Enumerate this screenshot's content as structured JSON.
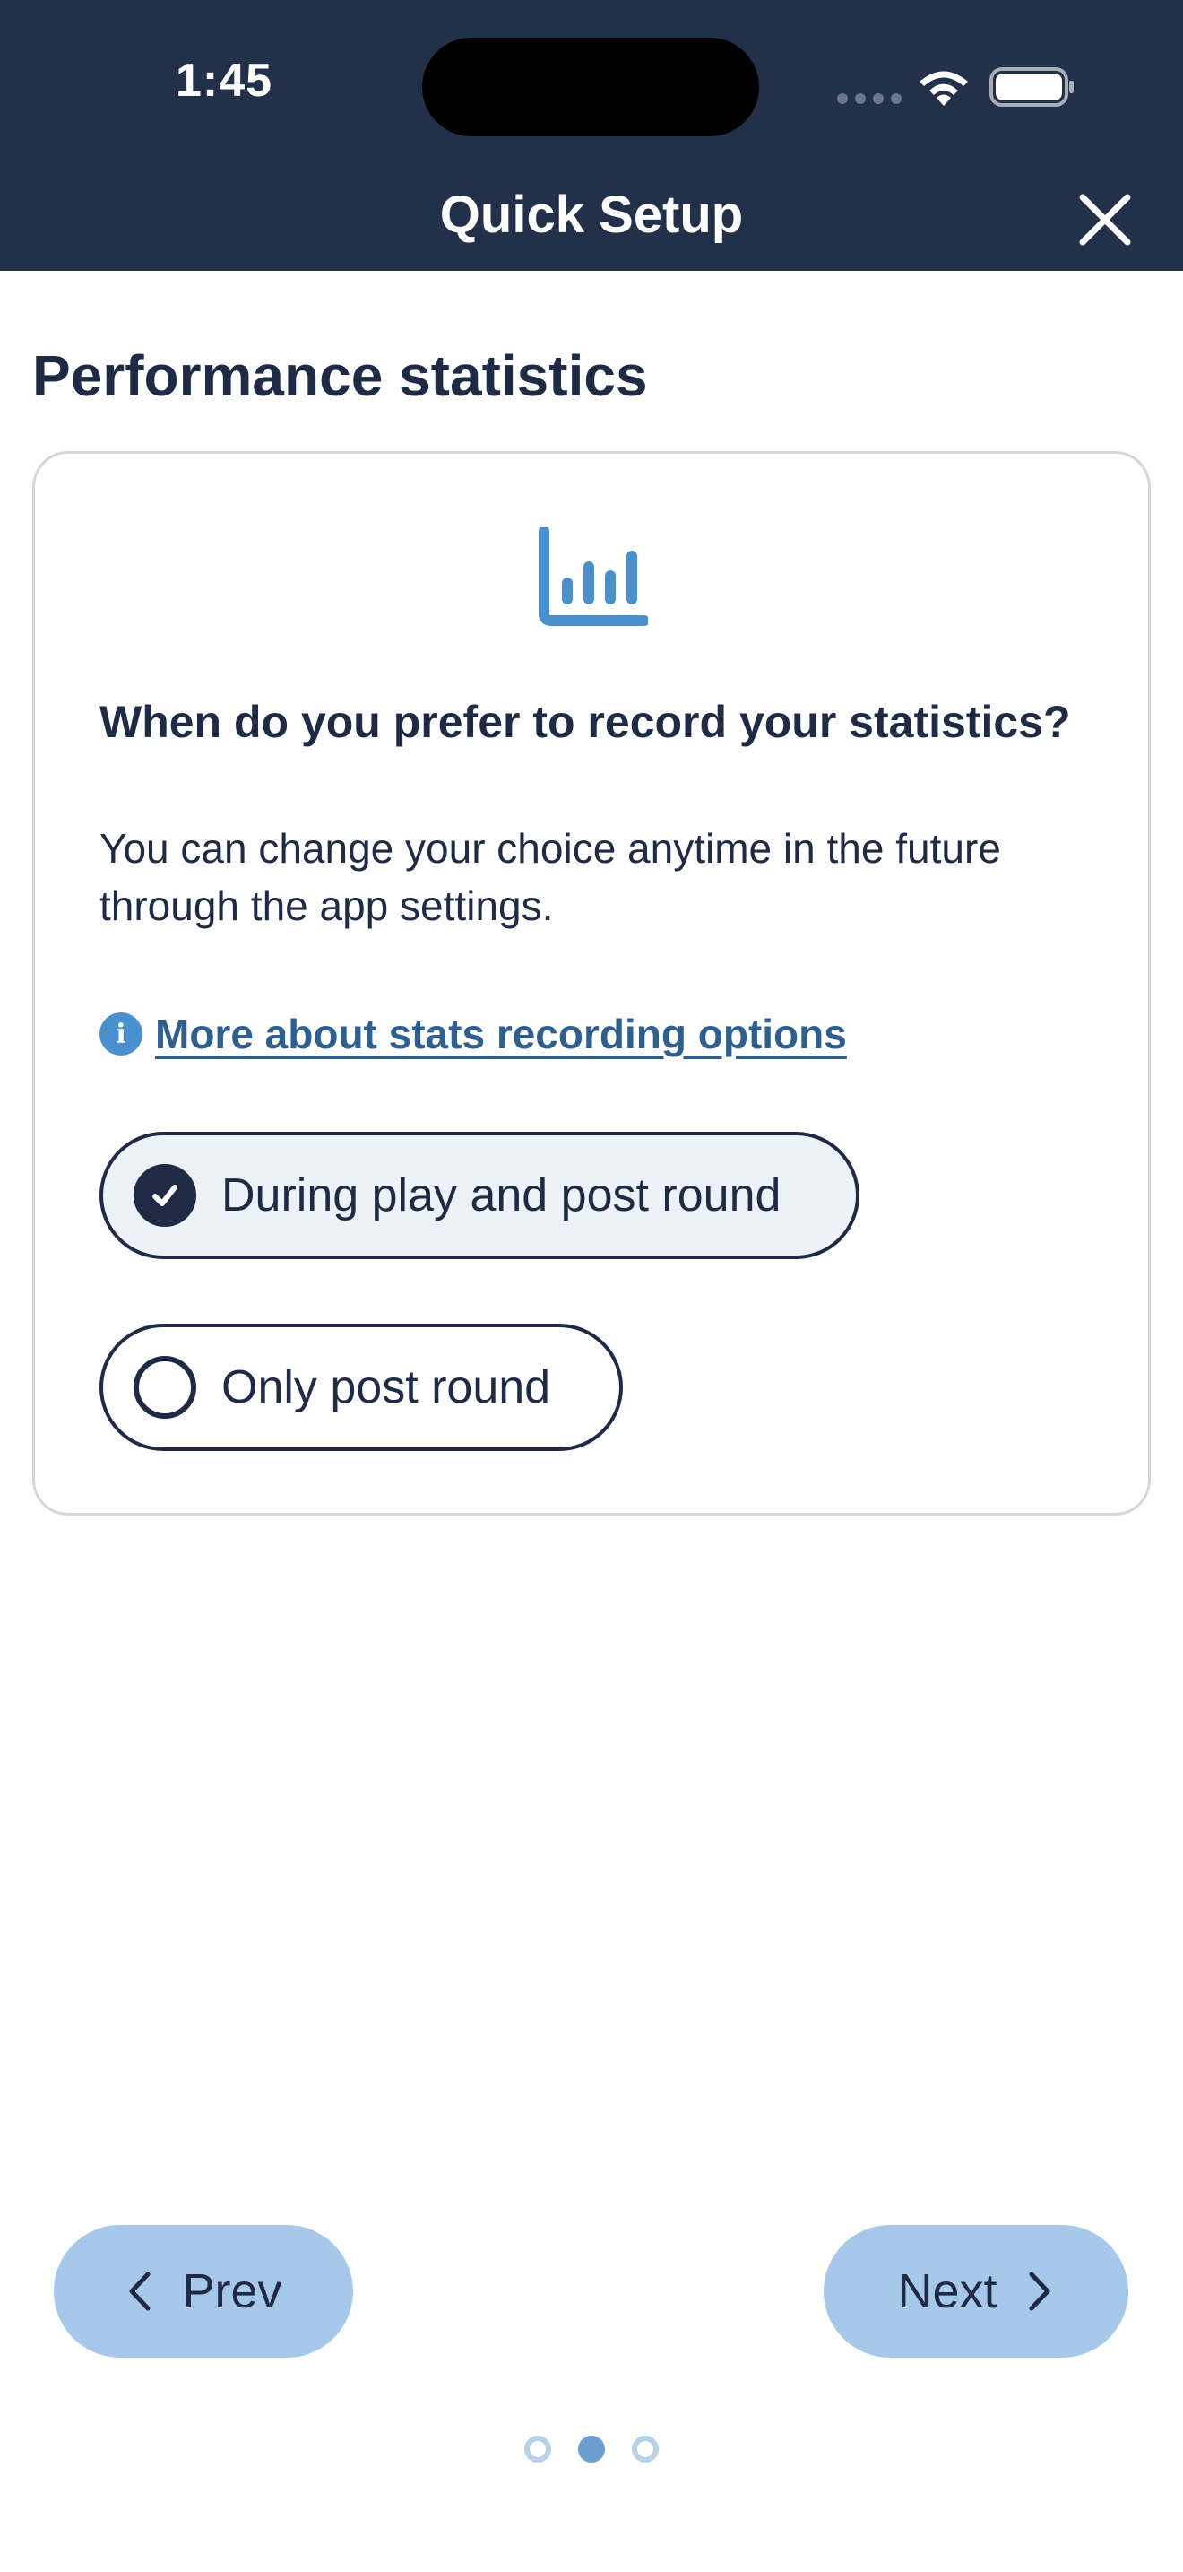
{
  "status_bar": {
    "time": "1:45"
  },
  "header": {
    "title": "Quick Setup",
    "close_icon": "close-icon"
  },
  "page": {
    "section_title": "Performance statistics",
    "card": {
      "icon": "bar-chart-icon",
      "question": "When do you prefer to record your statistics?",
      "description": "You can change your choice anytime in the future through the app settings.",
      "more_link": {
        "icon": "info-icon",
        "label": "More about stats recording options"
      },
      "options": [
        {
          "label": "During play and post round",
          "selected": true
        },
        {
          "label": "Only post round",
          "selected": false
        }
      ]
    }
  },
  "footer": {
    "prev_label": "Prev",
    "next_label": "Next",
    "pagination": {
      "total": 3,
      "current": 2
    }
  },
  "colors": {
    "header_bg": "#233049",
    "text_primary": "#1f2b45",
    "accent_blue": "#4b90ce",
    "link": "#2f5f8f",
    "nav_button_bg": "#a6c8ea",
    "selected_option_bg": "#edf2f8"
  }
}
